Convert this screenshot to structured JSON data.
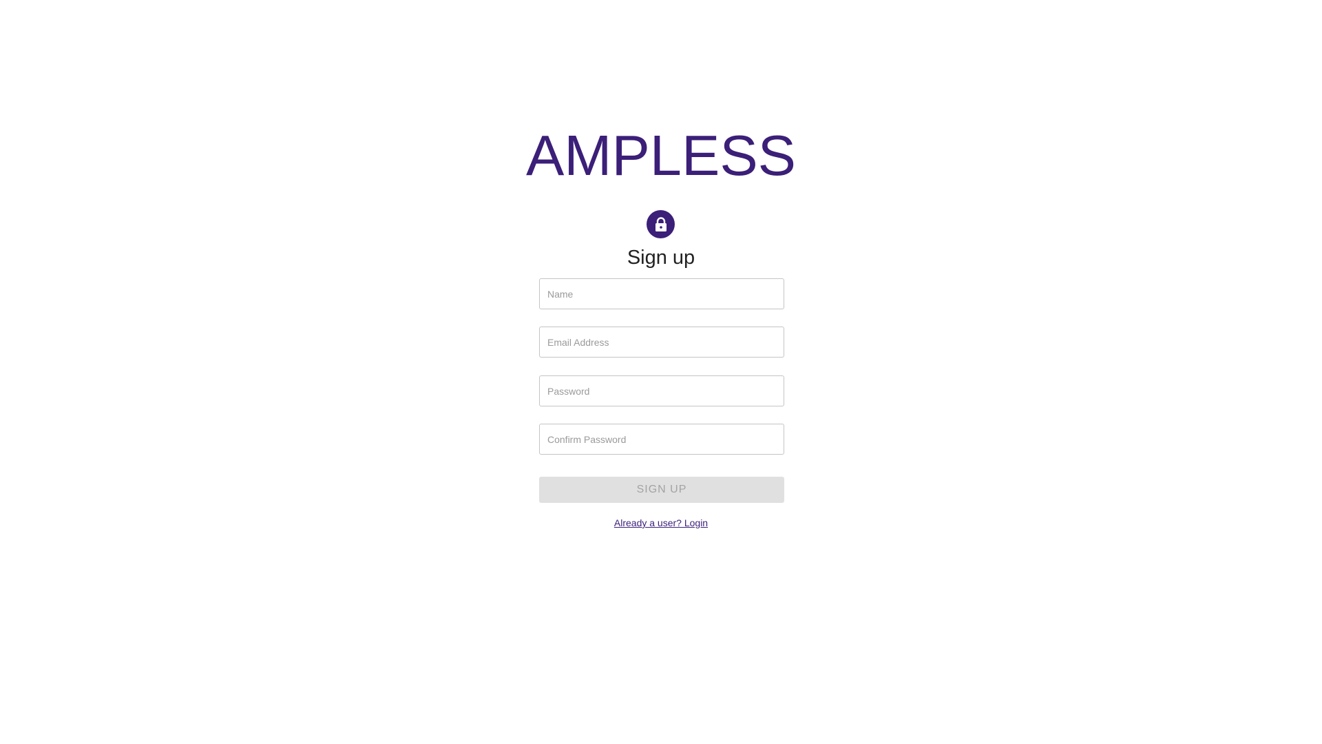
{
  "brand": {
    "name": "AMPLESS",
    "color": "#3b1f78"
  },
  "avatar": {
    "icon": "lock-icon"
  },
  "form": {
    "title": "Sign up",
    "fields": {
      "name": {
        "placeholder": "Name",
        "value": ""
      },
      "email": {
        "placeholder": "Email Address",
        "value": ""
      },
      "password": {
        "placeholder": "Password",
        "value": ""
      },
      "confirm_password": {
        "placeholder": "Confirm Password",
        "value": ""
      }
    },
    "submit_label": "SIGN UP",
    "submit_disabled": true,
    "login_link": "Already a user? Login"
  }
}
